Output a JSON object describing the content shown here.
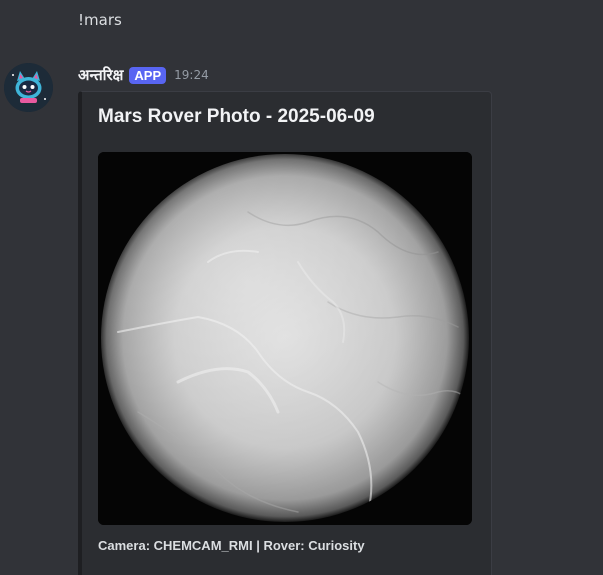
{
  "previous_message": {
    "text": "!mars"
  },
  "message": {
    "author": "अन्तरिक्ष",
    "badge": "APP",
    "timestamp": "19:24",
    "avatar_icon": "cat-astronaut-avatar-icon"
  },
  "embed": {
    "title": "Mars Rover Photo - 2025-06-09",
    "image_description_icon": "mars-surface-photo",
    "footer": "Camera: CHEMCAM_RMI | Rover: Curiosity"
  },
  "colors": {
    "background": "#313338",
    "embed_background": "#2b2d31",
    "badge": "#5865f2",
    "timestamp": "#949ba4"
  }
}
